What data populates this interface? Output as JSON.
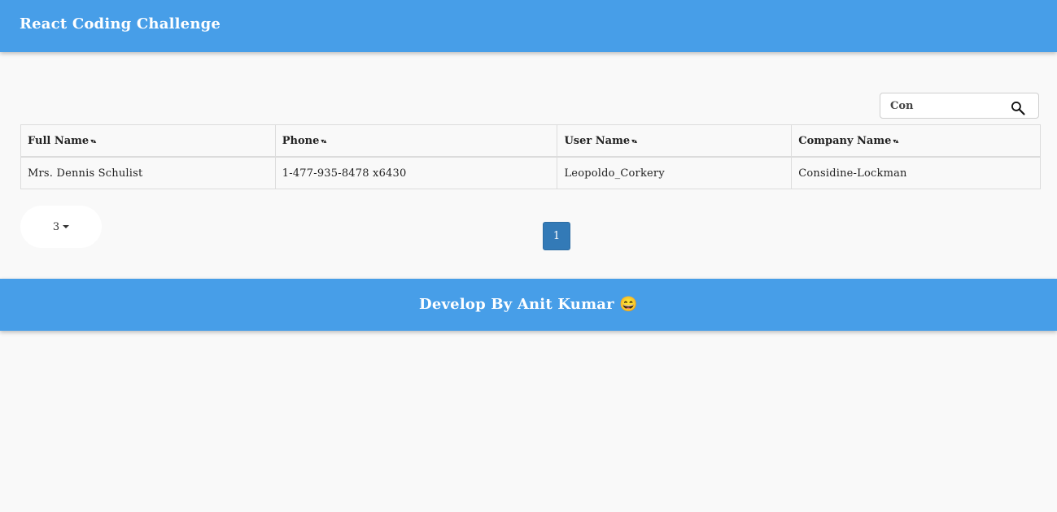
{
  "header": {
    "title": "React Coding Challenge"
  },
  "search": {
    "value": "Con",
    "icon": "search-icon"
  },
  "table": {
    "columns": [
      {
        "label": "Full Name",
        "sort_icon": "▾▴"
      },
      {
        "label": "Phone",
        "sort_icon": "▾▴"
      },
      {
        "label": "User Name",
        "sort_icon": "▾▴"
      },
      {
        "label": "Company Name",
        "sort_icon": "▾▴"
      }
    ],
    "rows": [
      [
        "Mrs. Dennis Schulist",
        "1-477-935-8478 x6430",
        "Leopoldo_Corkery",
        "Considine-Lockman"
      ]
    ]
  },
  "pagination": {
    "page_size": "3",
    "pages": [
      "1"
    ],
    "active_page": "1"
  },
  "footer": {
    "text": "Develop By Anit Kumar 😄"
  },
  "colors": {
    "bar": "#479ee8",
    "active_page": "#337ab7",
    "background": "#f9f9f9"
  }
}
